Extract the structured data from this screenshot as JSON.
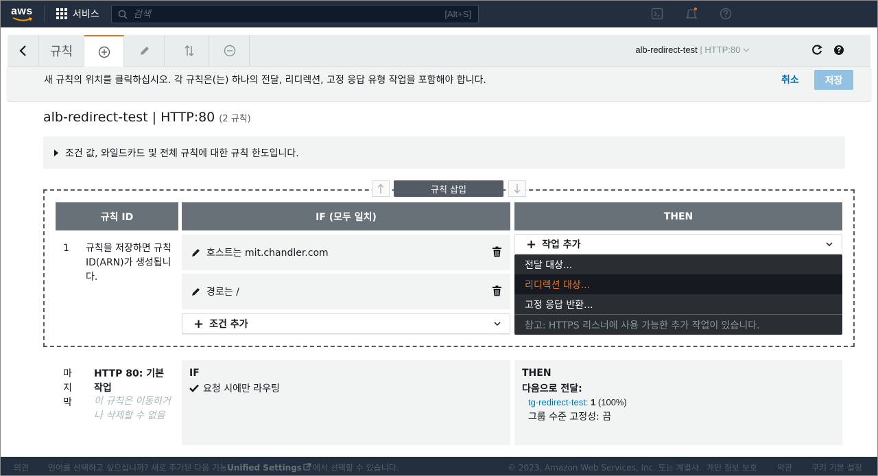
{
  "nav": {
    "logo_text": "aws",
    "services_label": "서비스",
    "search_placeholder": "검색",
    "search_shortcut": "[Alt+S]",
    "icons": [
      "cloudshell-icon",
      "bell-icon",
      "help-icon"
    ]
  },
  "toolbar": {
    "title": "규칙",
    "tabs": [
      "add-icon",
      "edit-icon",
      "reorder-icon",
      "delete-icon"
    ],
    "active_tab": "add-icon",
    "listener_name": "alb-redirect-test",
    "listener_separator": "|",
    "listener_port": "HTTP:80"
  },
  "infobar": {
    "message": "새 규칙의 위치를 클릭하십시오. 각 규칙은(는) 하나의 전달, 리디렉션, 고정 응답 유형 작업을 포함해야 합니다.",
    "cancel_label": "취소",
    "save_label": "저장"
  },
  "heading": {
    "title": "alb-redirect-test | HTTP:80",
    "count": "(2 규칙)"
  },
  "limits_text": "조건 값, 와일드카드 및 전체 규칙에 대한 규칙 한도입니다.",
  "insert_label": "규칙 삽입",
  "table": {
    "headers": [
      "규칙 ID",
      "IF (모두 일치)",
      "THEN"
    ]
  },
  "new_rule": {
    "id": "1",
    "note": "규칙을 저장하면 규칙 ID(ARN)가 생성됩니다.",
    "conditions": [
      {
        "text": "호스트는 mit.chandler.com"
      },
      {
        "text": "경로는 /"
      }
    ],
    "add_condition_label": "조건 추가",
    "add_action_label": "작업 추가",
    "menu": {
      "items": [
        "전달 대상...",
        "리디렉션 대상...",
        "고정 응답 반환..."
      ],
      "selected_index": 1,
      "note": "참고: HTTPS 리스너에 사용 가능한 추가 작업이 있습니다."
    }
  },
  "default_rule": {
    "label": "마지막",
    "title": "HTTP 80: 기본 작업",
    "note": "이 규칙은 이동하거나 삭제할 수 없음",
    "if_header": "IF",
    "if_text": "요청 시에만 라우팅",
    "then_header": "THEN",
    "forward_label": "다음으로 전달:",
    "target_group": "tg-redirect-test:",
    "target_weight": "1",
    "target_percent": "(100%)",
    "stickiness": "그룹 수준 고정성: 끔"
  },
  "footer": {
    "feedback": "의견",
    "language_prompt": "언어를 선택하고 싶으십니까? 새로 추가된 다음 기능",
    "unified_settings": "Unified Settings",
    "language_suffix": "에서 선택할 수 있습니다.",
    "copyright": "© 2023, Amazon Web Services, Inc. 또는 계열사.",
    "privacy": "개인 정보 보호",
    "terms": "약관",
    "cookies": "쿠키 기본 설정"
  },
  "colors": {
    "nav_bg": "#232f3e",
    "accent": "#ec7211",
    "link": "#0073bb",
    "header_bg": "#687078",
    "menu_bg": "#2a2e33"
  }
}
